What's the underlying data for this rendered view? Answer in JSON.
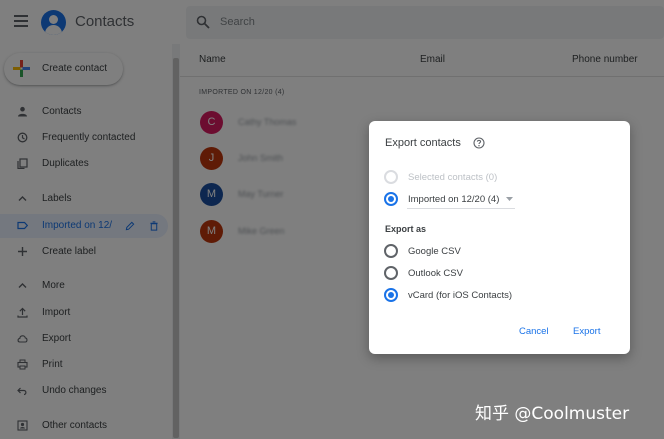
{
  "header": {
    "app_title": "Contacts",
    "search_placeholder": "Search"
  },
  "sidebar": {
    "create_label": "Create contact",
    "items": [
      {
        "label": "Contacts",
        "icon": "person-icon"
      },
      {
        "label": "Frequently contacted",
        "icon": "history-icon"
      },
      {
        "label": "Duplicates",
        "icon": "copy-icon"
      },
      {
        "label": "Labels",
        "icon": "chevron-up-icon"
      },
      {
        "label": "Imported on 12/",
        "icon": "label-icon"
      },
      {
        "label": "Create label",
        "icon": "add-icon"
      },
      {
        "label": "More",
        "icon": "chevron-up-icon"
      },
      {
        "label": "Import",
        "icon": "upload-icon"
      },
      {
        "label": "Export",
        "icon": "cloud-download-icon"
      },
      {
        "label": "Print",
        "icon": "print-icon"
      },
      {
        "label": "Undo changes",
        "icon": "undo-icon"
      },
      {
        "label": "Other contacts",
        "icon": "other-contacts-icon"
      }
    ]
  },
  "list": {
    "columns": [
      "Name",
      "Email",
      "Phone number"
    ],
    "group_label": "IMPORTED ON 12/20 (4)",
    "contacts": [
      {
        "initial": "C",
        "name": "Cathy Thomas",
        "color": "#d81b60"
      },
      {
        "initial": "J",
        "name": "John Smith",
        "color": "#bf360c"
      },
      {
        "initial": "M",
        "name": "May Turner",
        "color": "#1a4fa0"
      },
      {
        "initial": "M",
        "name": "Mike Green",
        "color": "#bf360c"
      }
    ]
  },
  "dialog": {
    "title": "Export contacts",
    "options": {
      "selected": "Selected contacts (0)",
      "imported": "Imported on 12/20 (4)"
    },
    "export_as_label": "Export as",
    "formats": [
      "Google CSV",
      "Outlook CSV",
      "vCard (for iOS Contacts)"
    ],
    "selected_format": "vCard (for iOS Contacts)",
    "cancel_label": "Cancel",
    "export_label": "Export"
  },
  "watermark": "知乎 @Coolmuster",
  "colors": {
    "accent": "#1a73e8",
    "scrim": "rgba(0,0,0,0.5)"
  }
}
